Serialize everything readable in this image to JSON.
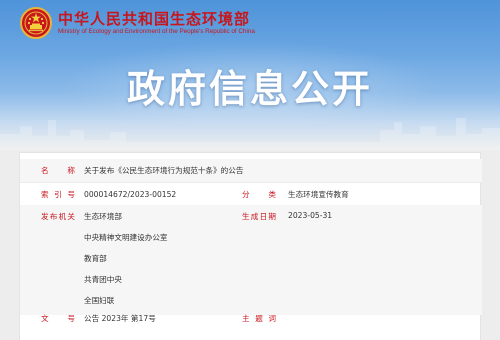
{
  "header": {
    "org_name_cn": "中华人民共和国生态环境部",
    "org_name_en": "Ministry of Ecology and Environment of the People's Republic of China",
    "emblem_icon": "national-emblem-icon",
    "page_title": "政府信息公开"
  },
  "colors": {
    "accent": "#c8161d",
    "hero_top": "#4f93d9",
    "hero_bottom": "#ededed"
  },
  "info": {
    "name_label": "名　称",
    "name_value": "关于发布《公民生态环境行为规范十条》的公告",
    "index_label": "索引号",
    "index_value": "000014672/2023-00152",
    "category_label": "分　类",
    "category_value": "生态环境宣传教育",
    "publisher_label": "发布机关",
    "publishers": [
      "生态环境部",
      "中央精神文明建设办公室",
      "教育部",
      "共青团中央",
      "全国妇联"
    ],
    "date_label": "生成日期",
    "date_value": "2023-05-31",
    "doc_no_label": "文　号",
    "doc_no_value": "公告 2023年 第17号",
    "subject_label": "主题词",
    "subject_value": ""
  }
}
